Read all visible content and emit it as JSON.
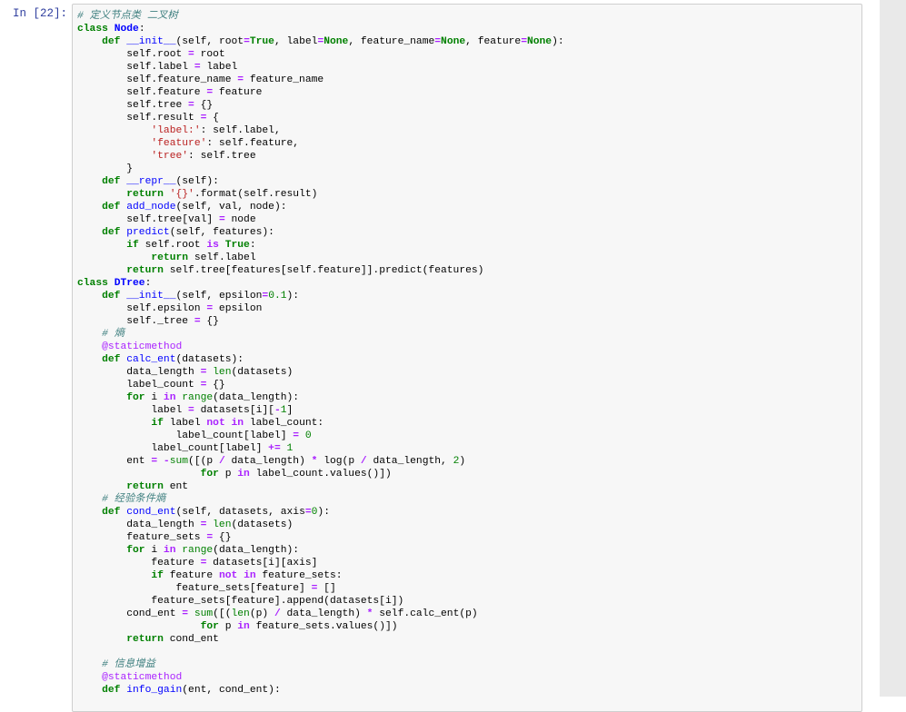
{
  "prompt": "In  [22]:",
  "code_lines": [
    [
      [
        "com",
        "# 定义节点类 二叉树"
      ]
    ],
    [
      [
        "kw",
        "class"
      ],
      [
        "plain",
        " "
      ],
      [
        "cls",
        "Node"
      ],
      [
        "plain",
        ":"
      ]
    ],
    [
      [
        "plain",
        "    "
      ],
      [
        "kw",
        "def"
      ],
      [
        "plain",
        " "
      ],
      [
        "def",
        "__init__"
      ],
      [
        "plain",
        "(self, root"
      ],
      [
        "op",
        "="
      ],
      [
        "kw",
        "True"
      ],
      [
        "plain",
        ", label"
      ],
      [
        "op",
        "="
      ],
      [
        "kw",
        "None"
      ],
      [
        "plain",
        ", feature_name"
      ],
      [
        "op",
        "="
      ],
      [
        "kw",
        "None"
      ],
      [
        "plain",
        ", feature"
      ],
      [
        "op",
        "="
      ],
      [
        "kw",
        "None"
      ],
      [
        "plain",
        "):"
      ]
    ],
    [
      [
        "plain",
        "        self.root "
      ],
      [
        "op",
        "="
      ],
      [
        "plain",
        " root"
      ]
    ],
    [
      [
        "plain",
        "        self.label "
      ],
      [
        "op",
        "="
      ],
      [
        "plain",
        " label"
      ]
    ],
    [
      [
        "plain",
        "        self.feature_name "
      ],
      [
        "op",
        "="
      ],
      [
        "plain",
        " feature_name"
      ]
    ],
    [
      [
        "plain",
        "        self.feature "
      ],
      [
        "op",
        "="
      ],
      [
        "plain",
        " feature"
      ]
    ],
    [
      [
        "plain",
        "        self.tree "
      ],
      [
        "op",
        "="
      ],
      [
        "plain",
        " {}"
      ]
    ],
    [
      [
        "plain",
        "        self.result "
      ],
      [
        "op",
        "="
      ],
      [
        "plain",
        " {"
      ]
    ],
    [
      [
        "plain",
        "            "
      ],
      [
        "str",
        "'label:'"
      ],
      [
        "plain",
        ": self.label,"
      ]
    ],
    [
      [
        "plain",
        "            "
      ],
      [
        "str",
        "'feature'"
      ],
      [
        "plain",
        ": self.feature,"
      ]
    ],
    [
      [
        "plain",
        "            "
      ],
      [
        "str",
        "'tree'"
      ],
      [
        "plain",
        ": self.tree"
      ]
    ],
    [
      [
        "plain",
        "        }"
      ]
    ],
    [
      [
        "plain",
        "    "
      ],
      [
        "kw",
        "def"
      ],
      [
        "plain",
        " "
      ],
      [
        "def",
        "__repr__"
      ],
      [
        "plain",
        "(self):"
      ]
    ],
    [
      [
        "plain",
        "        "
      ],
      [
        "kw",
        "return"
      ],
      [
        "plain",
        " "
      ],
      [
        "str",
        "'{}'"
      ],
      [
        "plain",
        ".format(self.result)"
      ]
    ],
    [
      [
        "plain",
        "    "
      ],
      [
        "kw",
        "def"
      ],
      [
        "plain",
        " "
      ],
      [
        "def",
        "add_node"
      ],
      [
        "plain",
        "(self, val, node):"
      ]
    ],
    [
      [
        "plain",
        "        self.tree[val] "
      ],
      [
        "op",
        "="
      ],
      [
        "plain",
        " node"
      ]
    ],
    [
      [
        "plain",
        "    "
      ],
      [
        "kw",
        "def"
      ],
      [
        "plain",
        " "
      ],
      [
        "def",
        "predict"
      ],
      [
        "plain",
        "(self, features):"
      ]
    ],
    [
      [
        "plain",
        "        "
      ],
      [
        "kw",
        "if"
      ],
      [
        "plain",
        " self.root "
      ],
      [
        "op",
        "is"
      ],
      [
        "plain",
        " "
      ],
      [
        "kw",
        "True"
      ],
      [
        "plain",
        ":"
      ]
    ],
    [
      [
        "plain",
        "            "
      ],
      [
        "kw",
        "return"
      ],
      [
        "plain",
        " self.label"
      ]
    ],
    [
      [
        "plain",
        "        "
      ],
      [
        "kw",
        "return"
      ],
      [
        "plain",
        " self.tree[features[self.feature]].predict(features)"
      ]
    ],
    [
      [
        "kw",
        "class"
      ],
      [
        "plain",
        " "
      ],
      [
        "cls",
        "DTree"
      ],
      [
        "plain",
        ":"
      ]
    ],
    [
      [
        "plain",
        "    "
      ],
      [
        "kw",
        "def"
      ],
      [
        "plain",
        " "
      ],
      [
        "def",
        "__init__"
      ],
      [
        "plain",
        "(self, epsilon"
      ],
      [
        "op",
        "="
      ],
      [
        "num",
        "0.1"
      ],
      [
        "plain",
        "):"
      ]
    ],
    [
      [
        "plain",
        "        self.epsilon "
      ],
      [
        "op",
        "="
      ],
      [
        "plain",
        " epsilon"
      ]
    ],
    [
      [
        "plain",
        "        self._tree "
      ],
      [
        "op",
        "="
      ],
      [
        "plain",
        " {}"
      ]
    ],
    [
      [
        "plain",
        "    "
      ],
      [
        "com",
        "# 熵"
      ]
    ],
    [
      [
        "plain",
        "    "
      ],
      [
        "dec",
        "@staticmethod"
      ]
    ],
    [
      [
        "plain",
        "    "
      ],
      [
        "kw",
        "def"
      ],
      [
        "plain",
        " "
      ],
      [
        "def",
        "calc_ent"
      ],
      [
        "plain",
        "(datasets):"
      ]
    ],
    [
      [
        "plain",
        "        data_length "
      ],
      [
        "op",
        "="
      ],
      [
        "plain",
        " "
      ],
      [
        "bi",
        "len"
      ],
      [
        "plain",
        "(datasets)"
      ]
    ],
    [
      [
        "plain",
        "        label_count "
      ],
      [
        "op",
        "="
      ],
      [
        "plain",
        " {}"
      ]
    ],
    [
      [
        "plain",
        "        "
      ],
      [
        "kw",
        "for"
      ],
      [
        "plain",
        " i "
      ],
      [
        "op",
        "in"
      ],
      [
        "plain",
        " "
      ],
      [
        "bi",
        "range"
      ],
      [
        "plain",
        "(data_length):"
      ]
    ],
    [
      [
        "plain",
        "            label "
      ],
      [
        "op",
        "="
      ],
      [
        "plain",
        " datasets[i]["
      ],
      [
        "op",
        "-"
      ],
      [
        "num",
        "1"
      ],
      [
        "plain",
        "]"
      ]
    ],
    [
      [
        "plain",
        "            "
      ],
      [
        "kw",
        "if"
      ],
      [
        "plain",
        " label "
      ],
      [
        "op",
        "not"
      ],
      [
        "plain",
        " "
      ],
      [
        "op",
        "in"
      ],
      [
        "plain",
        " label_count:"
      ]
    ],
    [
      [
        "plain",
        "                label_count[label] "
      ],
      [
        "op",
        "="
      ],
      [
        "plain",
        " "
      ],
      [
        "num",
        "0"
      ]
    ],
    [
      [
        "plain",
        "            label_count[label] "
      ],
      [
        "op",
        "+="
      ],
      [
        "plain",
        " "
      ],
      [
        "num",
        "1"
      ]
    ],
    [
      [
        "plain",
        "        ent "
      ],
      [
        "op",
        "="
      ],
      [
        "plain",
        " "
      ],
      [
        "op",
        "-"
      ],
      [
        "bi",
        "sum"
      ],
      [
        "plain",
        "([(p "
      ],
      [
        "op",
        "/"
      ],
      [
        "plain",
        " data_length) "
      ],
      [
        "op",
        "*"
      ],
      [
        "plain",
        " log(p "
      ],
      [
        "op",
        "/"
      ],
      [
        "plain",
        " data_length, "
      ],
      [
        "num",
        "2"
      ],
      [
        "plain",
        ")"
      ]
    ],
    [
      [
        "plain",
        "                    "
      ],
      [
        "kw",
        "for"
      ],
      [
        "plain",
        " p "
      ],
      [
        "op",
        "in"
      ],
      [
        "plain",
        " label_count.values()])"
      ]
    ],
    [
      [
        "plain",
        "        "
      ],
      [
        "kw",
        "return"
      ],
      [
        "plain",
        " ent"
      ]
    ],
    [
      [
        "plain",
        "    "
      ],
      [
        "com",
        "# 经验条件熵"
      ]
    ],
    [
      [
        "plain",
        "    "
      ],
      [
        "kw",
        "def"
      ],
      [
        "plain",
        " "
      ],
      [
        "def",
        "cond_ent"
      ],
      [
        "plain",
        "(self, datasets, axis"
      ],
      [
        "op",
        "="
      ],
      [
        "num",
        "0"
      ],
      [
        "plain",
        "):"
      ]
    ],
    [
      [
        "plain",
        "        data_length "
      ],
      [
        "op",
        "="
      ],
      [
        "plain",
        " "
      ],
      [
        "bi",
        "len"
      ],
      [
        "plain",
        "(datasets)"
      ]
    ],
    [
      [
        "plain",
        "        feature_sets "
      ],
      [
        "op",
        "="
      ],
      [
        "plain",
        " {}"
      ]
    ],
    [
      [
        "plain",
        "        "
      ],
      [
        "kw",
        "for"
      ],
      [
        "plain",
        " i "
      ],
      [
        "op",
        "in"
      ],
      [
        "plain",
        " "
      ],
      [
        "bi",
        "range"
      ],
      [
        "plain",
        "(data_length):"
      ]
    ],
    [
      [
        "plain",
        "            feature "
      ],
      [
        "op",
        "="
      ],
      [
        "plain",
        " datasets[i][axis]"
      ]
    ],
    [
      [
        "plain",
        "            "
      ],
      [
        "kw",
        "if"
      ],
      [
        "plain",
        " feature "
      ],
      [
        "op",
        "not"
      ],
      [
        "plain",
        " "
      ],
      [
        "op",
        "in"
      ],
      [
        "plain",
        " feature_sets:"
      ]
    ],
    [
      [
        "plain",
        "                feature_sets[feature] "
      ],
      [
        "op",
        "="
      ],
      [
        "plain",
        " []"
      ]
    ],
    [
      [
        "plain",
        "            feature_sets[feature].append(datasets[i])"
      ]
    ],
    [
      [
        "plain",
        "        cond_ent "
      ],
      [
        "op",
        "="
      ],
      [
        "plain",
        " "
      ],
      [
        "bi",
        "sum"
      ],
      [
        "plain",
        "([("
      ],
      [
        "bi",
        "len"
      ],
      [
        "plain",
        "(p) "
      ],
      [
        "op",
        "/"
      ],
      [
        "plain",
        " data_length) "
      ],
      [
        "op",
        "*"
      ],
      [
        "plain",
        " self.calc_ent(p)"
      ]
    ],
    [
      [
        "plain",
        "                    "
      ],
      [
        "kw",
        "for"
      ],
      [
        "plain",
        " p "
      ],
      [
        "op",
        "in"
      ],
      [
        "plain",
        " feature_sets.values()])"
      ]
    ],
    [
      [
        "plain",
        "        "
      ],
      [
        "kw",
        "return"
      ],
      [
        "plain",
        " cond_ent"
      ]
    ],
    [
      [
        "plain",
        ""
      ]
    ],
    [
      [
        "plain",
        "    "
      ],
      [
        "com",
        "# 信息增益"
      ]
    ],
    [
      [
        "plain",
        "    "
      ],
      [
        "dec",
        "@staticmethod"
      ]
    ],
    [
      [
        "plain",
        "    "
      ],
      [
        "kw",
        "def"
      ],
      [
        "plain",
        " "
      ],
      [
        "def",
        "info_gain"
      ],
      [
        "plain",
        "(ent, cond_ent):"
      ]
    ]
  ]
}
